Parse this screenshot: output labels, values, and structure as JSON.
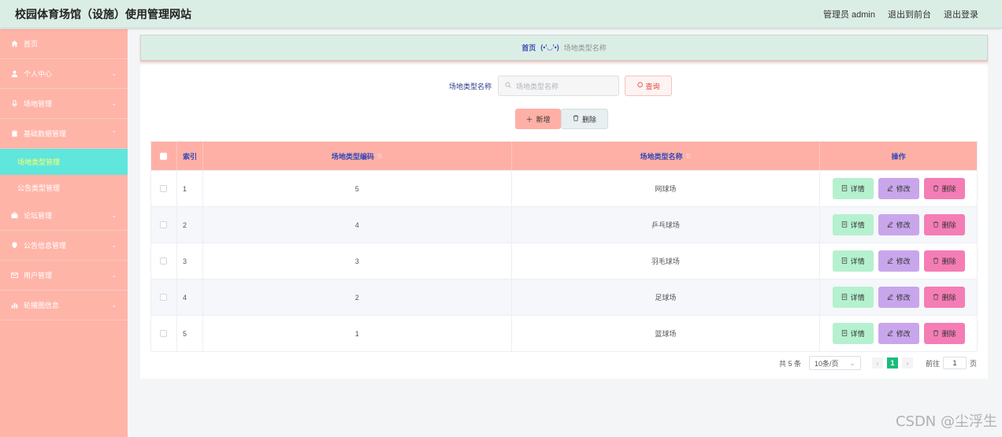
{
  "header": {
    "title": "校园体育场馆（设施）使用管理网站",
    "admin_label": "管理员 admin",
    "front_label": "退出到前台",
    "logout_label": "退出登录"
  },
  "sidebar": {
    "items": [
      {
        "label": "首页",
        "icon": "home-icon"
      },
      {
        "label": "个人中心",
        "icon": "user-icon"
      },
      {
        "label": "场地管理",
        "icon": "mic-icon"
      },
      {
        "label": "基础数据管理",
        "icon": "clipboard-icon"
      },
      {
        "label": "论坛管理",
        "icon": "briefcase-icon"
      },
      {
        "label": "公告信息管理",
        "icon": "location-icon"
      },
      {
        "label": "用户管理",
        "icon": "mail-icon"
      },
      {
        "label": "轮播图信息",
        "icon": "bar-chart-icon"
      }
    ],
    "sub": [
      {
        "label": "场地类型管理",
        "active": true
      },
      {
        "label": "公告类型管理",
        "active": false
      }
    ]
  },
  "breadcrumb": {
    "home": "首页",
    "face": "(•'◡'•)",
    "current": "场地类型名称"
  },
  "search": {
    "label": "场地类型名称",
    "placeholder": "场地类型名称",
    "query_label": "查询"
  },
  "actions": {
    "add_label": "新增",
    "delete_label": "删除"
  },
  "table": {
    "headers": [
      "索引",
      "场地类型编码",
      "场地类型名称",
      "操作"
    ],
    "rows": [
      {
        "index": "1",
        "code": "5",
        "name": "网球场"
      },
      {
        "index": "2",
        "code": "4",
        "name": "乒乓球场"
      },
      {
        "index": "3",
        "code": "3",
        "name": "羽毛球场"
      },
      {
        "index": "4",
        "code": "2",
        "name": "足球场"
      },
      {
        "index": "5",
        "code": "1",
        "name": "篮球场"
      }
    ],
    "op_detail": "详情",
    "op_edit": "修改",
    "op_delete": "删除"
  },
  "pager": {
    "total": "共 5 条",
    "page_size": "10条/页",
    "current_page": "1",
    "goto_label": "前往",
    "goto_value": "1",
    "page_unit": "页"
  },
  "watermark": "CSDN @尘浮生"
}
